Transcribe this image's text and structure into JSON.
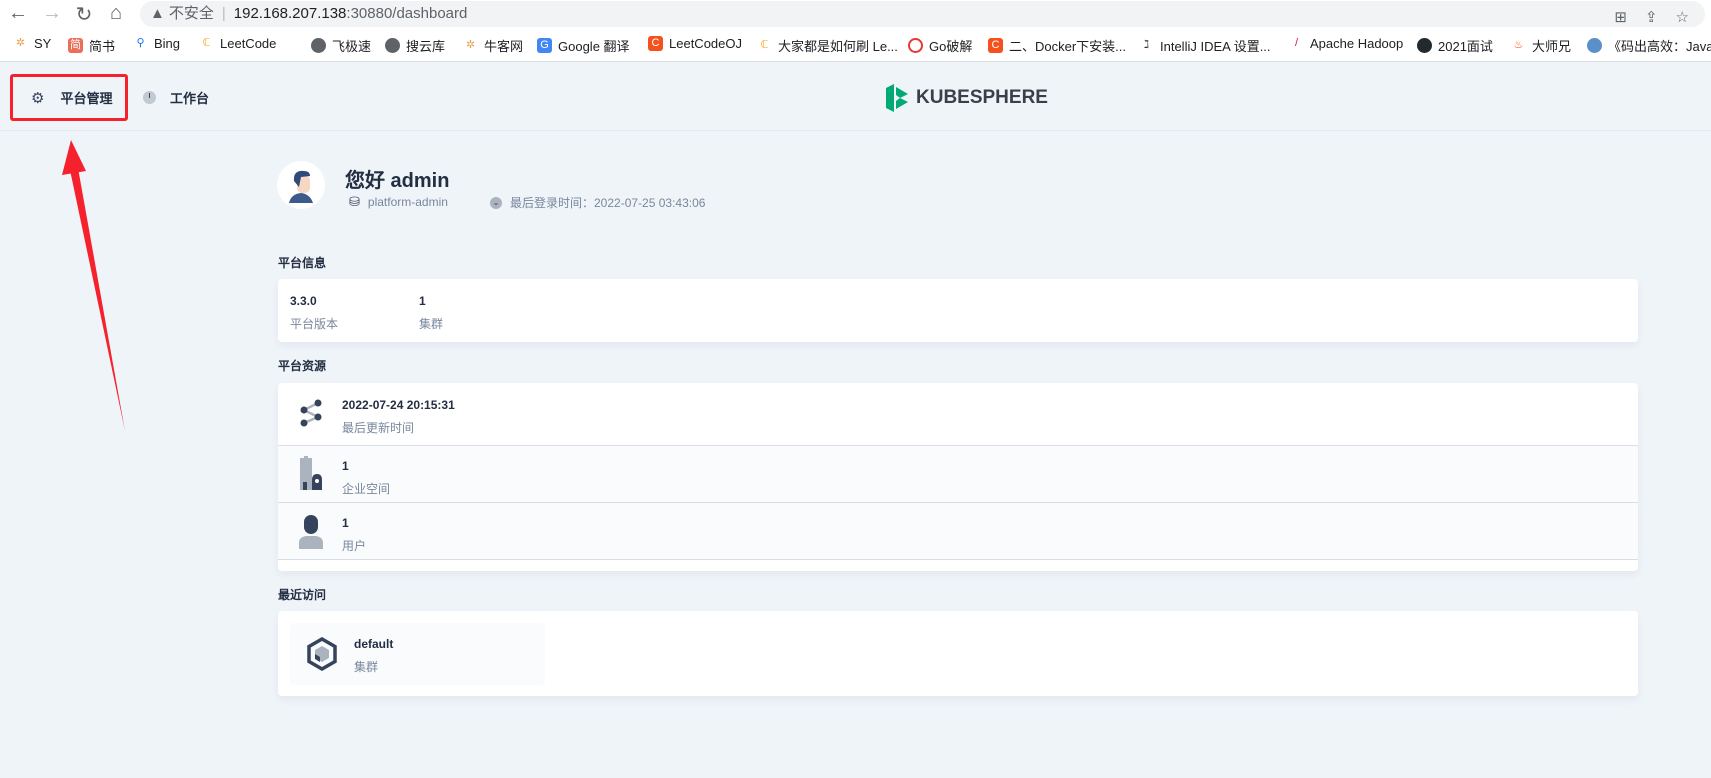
{
  "browser": {
    "insecure_label": "不安全",
    "url_host": "192.168.207.138",
    "url_rest": ":30880/dashboard",
    "bookmarks": [
      "SY",
      "简书",
      "Bing",
      "LeetCode",
      "飞极速",
      "搜云库",
      "牛客网",
      "Google 翻译",
      "LeetCodeOJ",
      "大家都是如何刷 Le...",
      "Go破解",
      "二、Docker下安装...",
      "IntelliJ IDEA 设置...",
      "Apache Hadoop",
      "2021面试",
      "大师兄",
      "《码出高效：Java..."
    ]
  },
  "topnav": {
    "platform": "平台管理",
    "workbench": "工作台",
    "logo": "KUBESPHERE"
  },
  "user": {
    "greeting": "您好 admin",
    "role": "platform-admin",
    "last_login": "最后登录时间：2022-07-25 03:43:06"
  },
  "platform_info": {
    "title": "平台信息",
    "items": [
      {
        "value": "3.3.0",
        "label": "平台版本"
      },
      {
        "value": "1",
        "label": "集群"
      }
    ]
  },
  "platform_resources": {
    "title": "平台资源",
    "rows": [
      {
        "value": "2022-07-24 20:15:31",
        "label": "最后更新时间"
      },
      {
        "value": "1",
        "label": "企业空间"
      },
      {
        "value": "1",
        "label": "用户"
      }
    ]
  },
  "recent": {
    "title": "最近访问",
    "items": [
      {
        "name": "default",
        "type": "集群"
      }
    ]
  },
  "colors": {
    "accent": "#00aa72",
    "annotation": "#f5222d"
  }
}
